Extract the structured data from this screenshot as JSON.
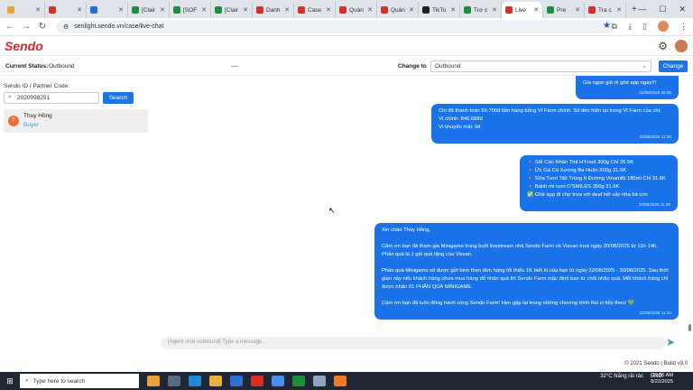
{
  "browser": {
    "tabs": [
      {
        "label": "",
        "color": "#e8a13a"
      },
      {
        "label": "",
        "color": "#d93025"
      },
      {
        "label": "",
        "color": "#2b67d6"
      },
      {
        "label": "[Clair",
        "color": "#1e8e3e"
      },
      {
        "label": "[SOF",
        "color": "#1e8e3e"
      },
      {
        "label": "[Clair",
        "color": "#1e8e3e"
      },
      {
        "label": "Danh",
        "color": "#d93025"
      },
      {
        "label": "Case",
        "color": "#d93025"
      },
      {
        "label": "Quản",
        "color": "#d93025"
      },
      {
        "label": "Quản",
        "color": "#d93025"
      },
      {
        "label": "TikTo",
        "color": "#222222"
      },
      {
        "label": "Trợ c",
        "color": "#1e8e3e"
      },
      {
        "label": "Live",
        "color": "#d93025"
      },
      {
        "label": "Pre",
        "color": "#1e8e3e"
      },
      {
        "label": "Tra c",
        "color": "#d93025"
      }
    ],
    "url": "senlight.sendo.vn/case/live-chat"
  },
  "app": {
    "logo": "Sendo"
  },
  "status": {
    "current_label": "Current Status:",
    "current_value": "Outbound",
    "middle": "----",
    "change_label": "Change to",
    "select_value": "Outbound",
    "change_button": "Change"
  },
  "sidebar": {
    "search_label": "Sendo ID / Partner Code:",
    "search_value": "2020098251",
    "search_button": "Search",
    "contact": {
      "initial": "T",
      "name": "Thuy Hồng",
      "status": "Buyer"
    }
  },
  "messages": [
    {
      "lines": [
        "Giá ngon giá rẻ ghé app ngay!!!"
      ],
      "time": "22/08/2025 06:35"
    },
    {
      "lines": [
        "Chị đã thanh toán 59.700đ tiền hàng bằng Ví Farm chính. Số tiền hiện tại trong Ví Farm của chị:",
        "Ví chính: 846.688đ",
        "Ví khuyến mãi: 0đ"
      ],
      "time": "22/08/2025 11:30"
    },
    {
      "lines": [
        "🔸 Sốt Cảo Nhân Thịt H'Food 300g Chỉ 26.5K",
        "🔸 Ức Gà Có Xương Ba Huân 500g 31.5K",
        "🔸 Sữa Tươi Tiệt Trùng Ít Đường Vinamilk 180ml Chỉ 31.6K",
        "🔸 Bánh mì tươi O'SMILES 350g 31.9K",
        "✅ Ghé app đi chợ trưa với deal hết sẩy nha bà con"
      ],
      "time": "22/08/2025 11:30"
    },
    {
      "lines": [
        "Xin chào Thúy Hồng,",
        "",
        "Cảm ơn bạn đã tham gia Minigame trong buổi livestream nhà Sendo Farm và Vissan trưa ngày 20/08/2025 từ 11h-14h. Phần quà là 1 giỏ quà tặng của Vissan.",
        "",
        "Phần quà Minigame sẽ được gửi kèm theo đơn hàng tối thiểu 1K biết kì của bạn từ ngày 22/08/2025 - 30/08/2025. Sau thời gian này nếu khách hàng chưa mua hàng để nhận quà thì Sendo Farm mặc định bạn từ chối nhận quà. Mỗi khách hàng chỉ được nhận 01 PHẦN QUÀ MINIGAME.",
        "",
        "Cảm ơn bạn đã luôn đồng hành cùng Sendo Farm! Hẹn gặp lại trong những chương trình thú vị tiếp theo! 💚"
      ],
      "time": "22/08/2025 11:34"
    }
  ],
  "composer": {
    "placeholder": "[Agent chat outbound] Type a message..."
  },
  "footer": {
    "text": "© 2021 Sendo | Build v3.0"
  },
  "taskbar": {
    "search_placeholder": "Type here to search",
    "weather": "32°C  Nắng rải rác",
    "lang": "ENG",
    "time": "11:55 AM",
    "date": "8/22/2025"
  }
}
